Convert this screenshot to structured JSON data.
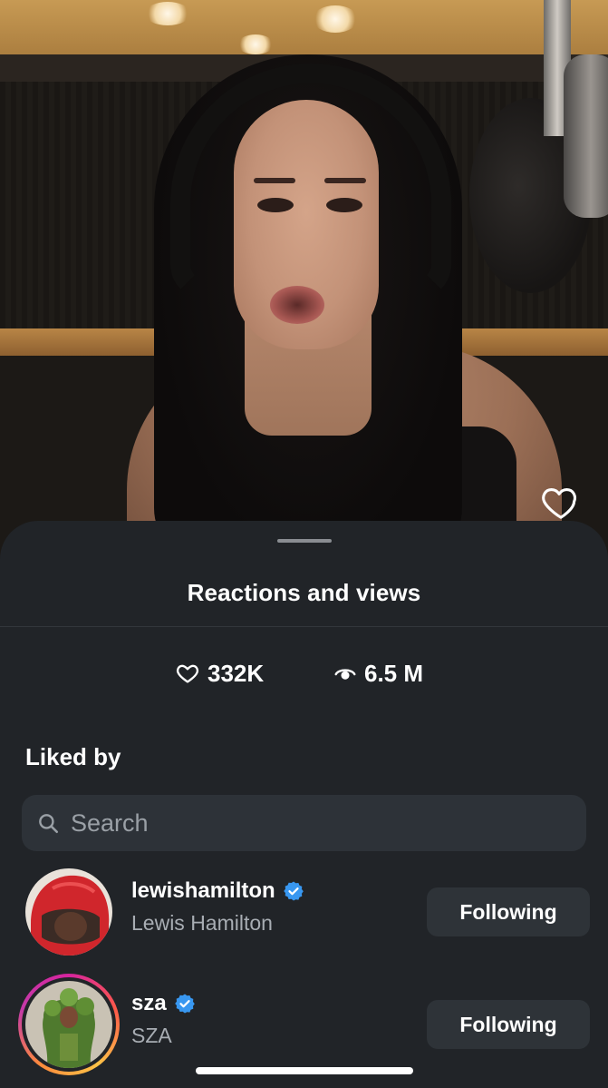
{
  "sheet": {
    "title": "Reactions and views"
  },
  "stats": {
    "likes": "332K",
    "views": "6.5 M"
  },
  "liked_by": {
    "label": "Liked by",
    "search_placeholder": "Search"
  },
  "users": [
    {
      "username": "lewishamilton",
      "full_name": "Lewis Hamilton",
      "verified": true,
      "button_label": "Following",
      "story_ring": false
    },
    {
      "username": "sza",
      "full_name": "SZA",
      "verified": true,
      "button_label": "Following",
      "story_ring": true
    }
  ],
  "colors": {
    "sheet_background": "#212428",
    "verified_badge": "#3897f0",
    "secondary_text": "#a8adb3"
  },
  "icons": {
    "like": "heart-outline-icon",
    "views": "eye-icon",
    "search": "search-icon",
    "verified": "verified-badge-icon"
  }
}
